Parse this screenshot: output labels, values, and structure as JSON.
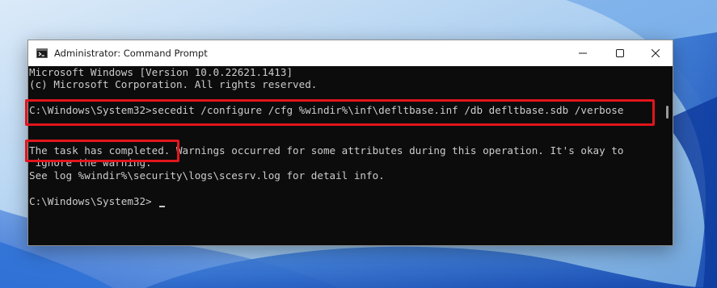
{
  "window": {
    "title": "Administrator: Command Prompt",
    "icon": "cmd-icon",
    "controls": {
      "minimize": "minimize-icon",
      "maximize": "maximize-icon",
      "close": "close-icon"
    }
  },
  "console": {
    "lines": [
      "Microsoft Windows [Version 10.0.22621.1413]",
      "(c) Microsoft Corporation. All rights reserved.",
      "",
      "C:\\Windows\\System32>secedit /configure /cfg %windir%\\inf\\defltbase.inf /db defltbase.sdb /verbose",
      "",
      "The task has completed. Warnings occurred for some attributes during this operation. It's okay to",
      " ignore the warning.",
      "See log %windir%\\security\\logs\\scesrv.log for detail info.",
      "",
      "C:\\Windows\\System32>"
    ]
  },
  "colors": {
    "console_bg": "#0c0c0c",
    "console_text": "#cccccc",
    "highlight": "#e2151c"
  }
}
